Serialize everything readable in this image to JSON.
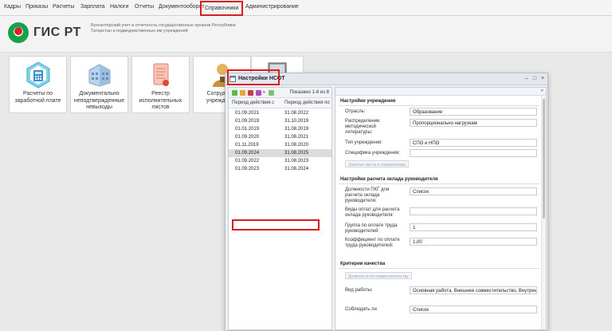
{
  "menu": [
    {
      "label": "Кадры",
      "key": "kadry"
    },
    {
      "label": "Приказы",
      "key": "prikazy"
    },
    {
      "label": "Расчеты",
      "key": "raschety"
    },
    {
      "label": "Зарплата",
      "key": "zarplata"
    },
    {
      "label": "Налоги",
      "key": "nalogi"
    },
    {
      "label": "Отчеты",
      "key": "otchety"
    },
    {
      "label": "Документооборот",
      "key": "dokumentooborot"
    },
    {
      "label": "Справочники",
      "key": "spravochniki",
      "active": true
    },
    {
      "label": "Администрирование",
      "key": "administrirovanie"
    }
  ],
  "header": {
    "brand": "ГИС РТ",
    "org": "Бухгалтерский учет и отчетность государственных органов Республики Татарстан и подведомственных им учреждений"
  },
  "tiles": [
    {
      "label": "Расчеты по заработной плате",
      "icon": "calculator-badge-icon"
    },
    {
      "label": "Документально неподтвержденные невыходы",
      "icon": "building-icon"
    },
    {
      "label": "Реестр исполнительных листов",
      "icon": "scroll-document-icon"
    },
    {
      "label": "Сотрудники учреждения",
      "icon": "person-icon"
    },
    {
      "label": "",
      "icon": "monitor-icon"
    }
  ],
  "window": {
    "title": "Настройки НСОТ",
    "shown": "Показано 1-8 из 8",
    "columns": [
      "Период действия с",
      "Период действия по"
    ],
    "rows": [
      [
        "01.09.2021",
        "31.08.2022"
      ],
      [
        "01.09.2019",
        "31.10.2019"
      ],
      [
        "01.01.2019",
        "31.08.2019"
      ],
      [
        "01.09.2020",
        "31.08.2021"
      ],
      [
        "01.11.2019",
        "31.08.2020"
      ],
      [
        "01.09.2024",
        "31.08.2025"
      ],
      [
        "01.09.2022",
        "31.08.2023"
      ],
      [
        "01.09.2023",
        "31.08.2024"
      ]
    ],
    "selected_row": 5,
    "settings": {
      "section1": "Настройки учреждения",
      "otrasl_label": "Отрасль:",
      "otrasl_value": "Образование",
      "raspr_label": "Распределение методической литературы:",
      "raspr_value": "Пропорционально нагрузкам",
      "tip_label": "Тип учреждения:",
      "tip_value": "СПО и НПО",
      "spec_label": "Специфика учреждения:",
      "spec_value": "",
      "btn1": "Занятые места в справочниках",
      "section2": "Настройки расчета оклада руководителя",
      "dolzh_label": "Должности ПКГ для расчета оклада руководителя:",
      "dolzh_value": "Список",
      "vidy_label": "Виды оплат для расчета оклада руководителя:",
      "vidy_value": "",
      "gruppa_label": "Группа по оплате труда руководителей:",
      "gruppa_value": "1",
      "koef_label": "Коэффициент по оплате труда руководителей:",
      "koef_value": "1,00",
      "section3": "Критерии качества",
      "btn2": "Должности по совместительству",
      "vid_label": "Вид работы:",
      "vid_value": "Основная работа, Внешнее совместительство, Внутрен",
      "more_label": "Соблюдать ли",
      "more_value": "Список"
    }
  }
}
